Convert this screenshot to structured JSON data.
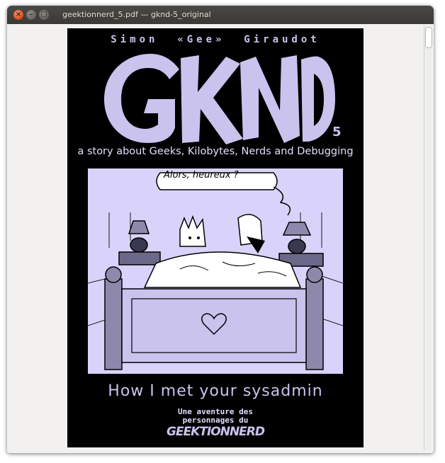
{
  "window": {
    "title": "geektionnerd_5.pdf — gknd-5_original",
    "close_glyph": "×",
    "minimize_glyph": "–",
    "maximize_glyph": "□"
  },
  "cover": {
    "author": "Simon  «Gee»  Giraudot",
    "logo_text": "GKND",
    "issue_number": "5",
    "tagline": "a story about Geeks, Kilobytes, Nerds and Debugging",
    "speech_bubble": "Alors, heureux ?",
    "subtitle": "How I met your sysadmin",
    "adventure_line1": "Une aventure des",
    "adventure_line2": "personnages du",
    "brand": "GEEKTIONNERD"
  },
  "colors": {
    "page_background": "#000000",
    "lavender": "#c9c3ee",
    "art_background": "#d9d3fb"
  }
}
